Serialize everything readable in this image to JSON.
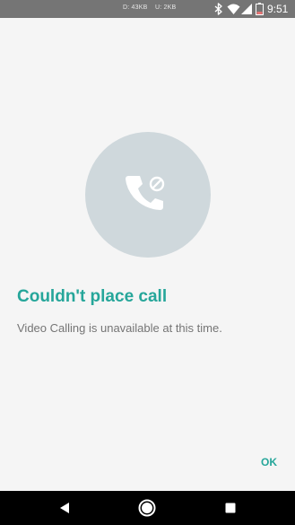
{
  "status_bar": {
    "net_down": "D: 43KB",
    "net_up": "U: 2KB",
    "time": "9:51",
    "icons": [
      "bluetooth-icon",
      "wifi-icon",
      "cellular-signal-icon",
      "battery-low-icon"
    ]
  },
  "dialog": {
    "icon": "call-blocked-icon",
    "title": "Couldn't place call",
    "message": "Video Calling is unavailable at this time.",
    "ok_label": "OK"
  },
  "nav_bar": {
    "icons": [
      "back-icon",
      "home-icon",
      "recents-icon"
    ]
  },
  "colors": {
    "accent": "#26a69a",
    "icon_circle": "#cfd8dc",
    "status_bar": "#757575",
    "background": "#f5f5f5",
    "battery_low": "#e57373"
  }
}
